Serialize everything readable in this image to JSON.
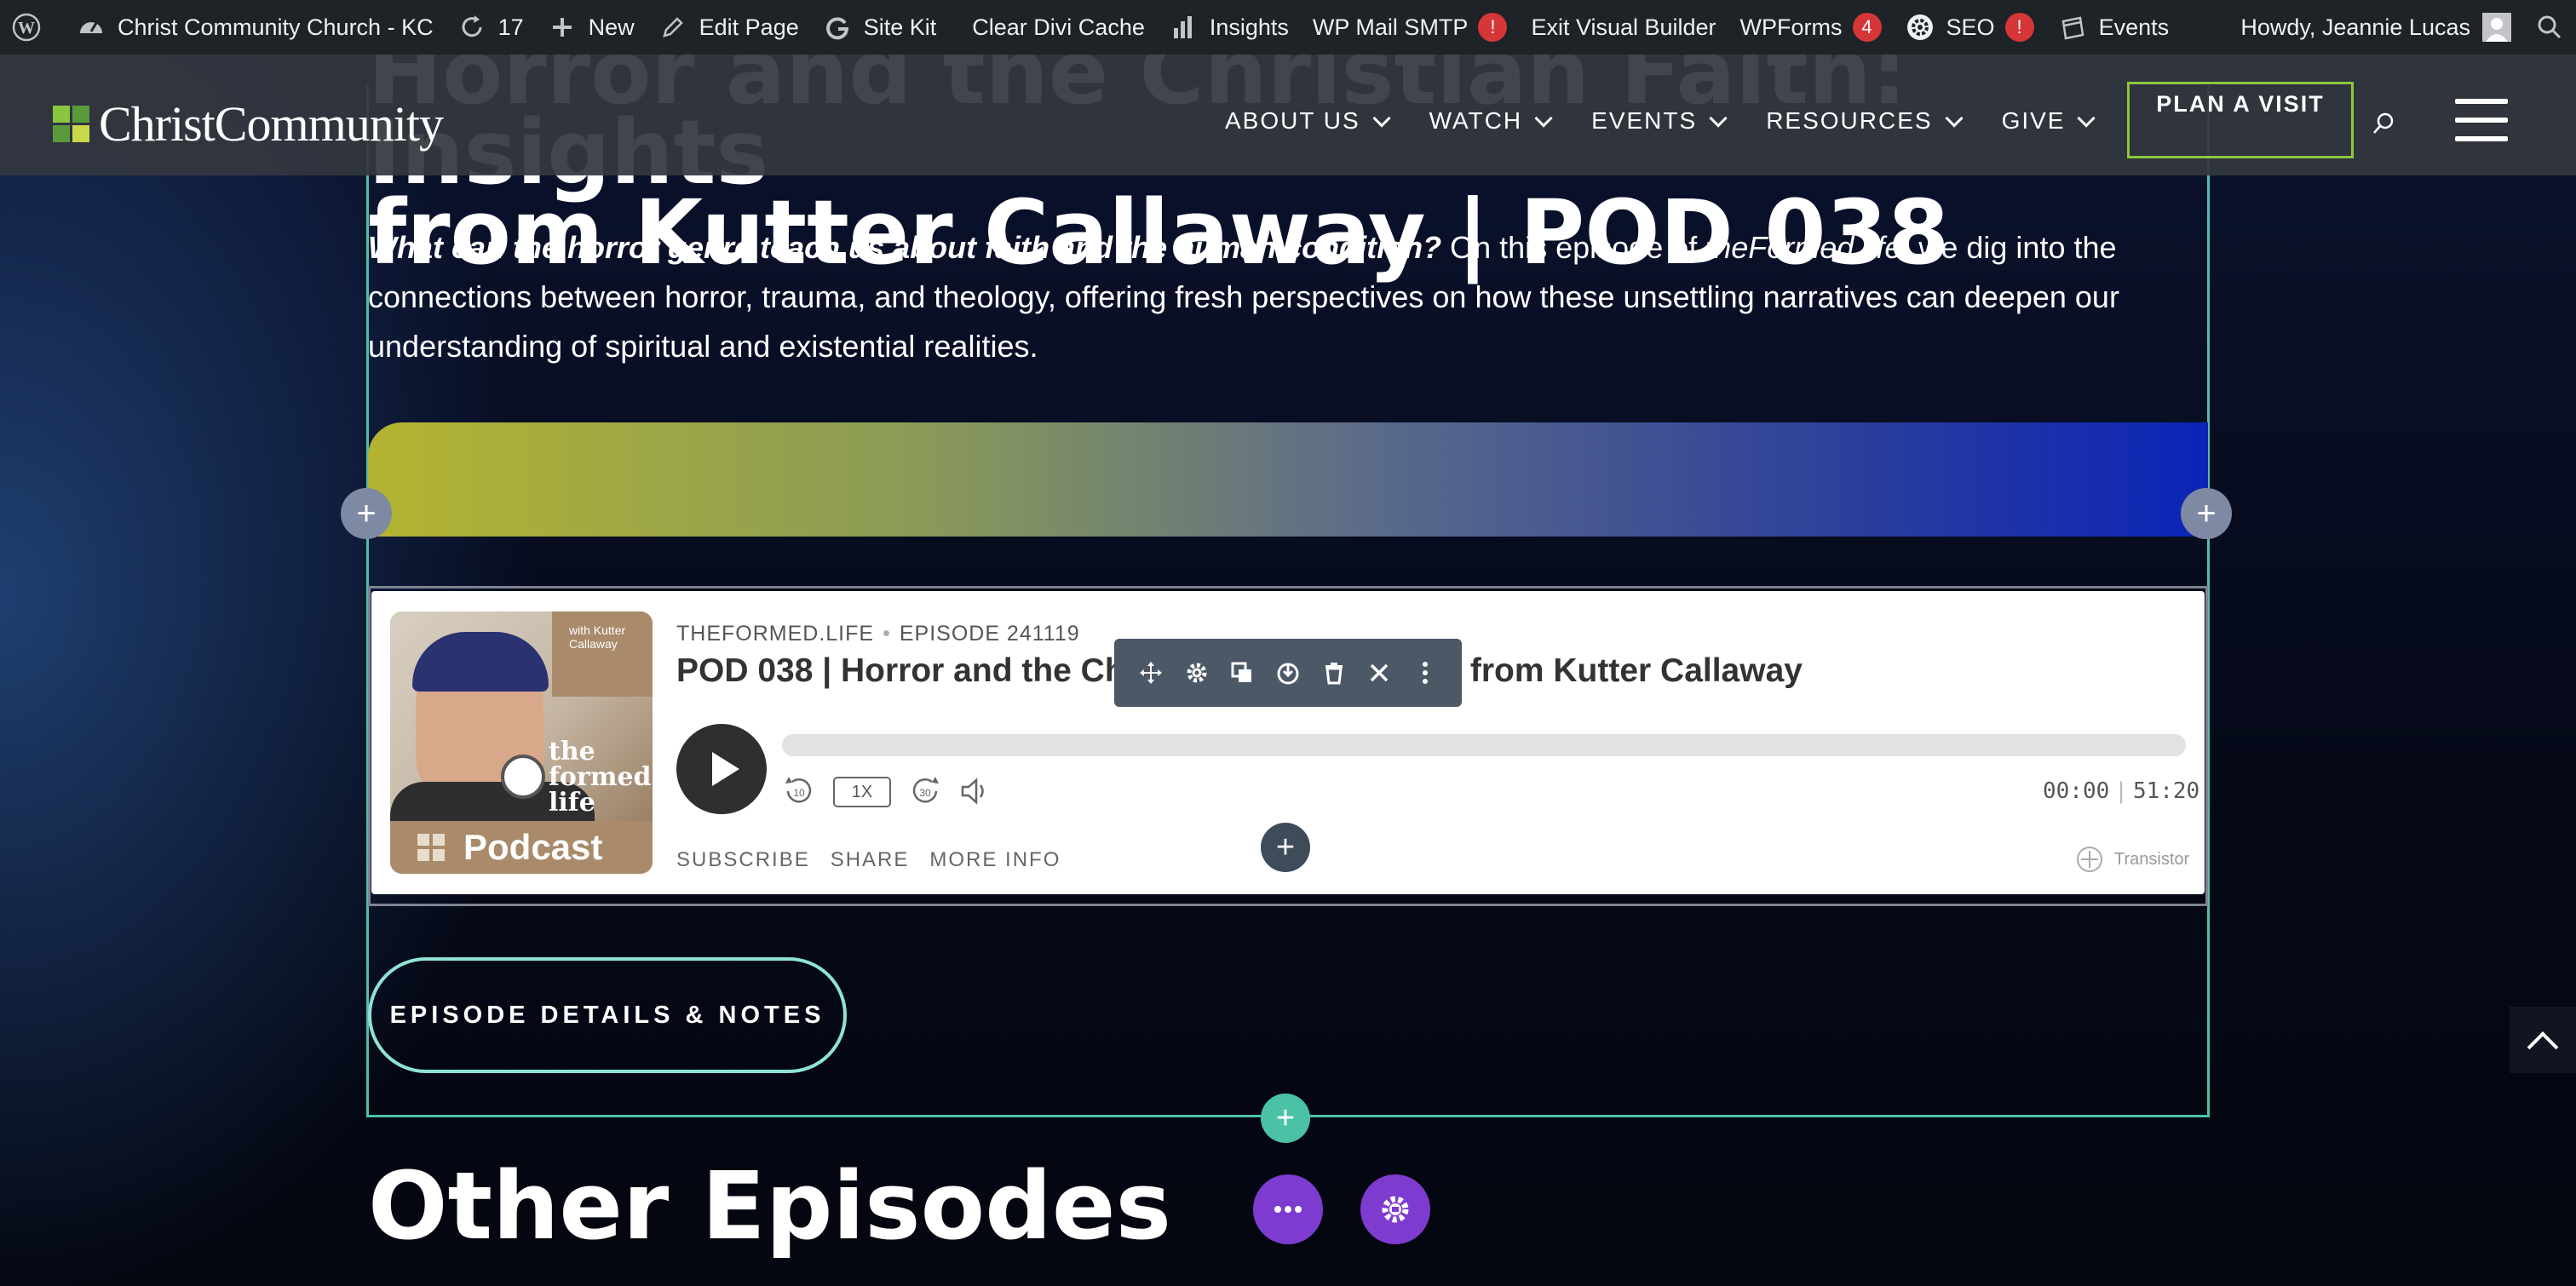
{
  "admin_bar": {
    "site_name": "Christ Community Church - KC",
    "updates_count": "17",
    "new_label": "New",
    "edit_page_label": "Edit Page",
    "site_kit_label": "Site Kit",
    "clear_cache_label": "Clear Divi Cache",
    "insights_label": "Insights",
    "wp_mail_label": "WP Mail SMTP",
    "wp_mail_badge": "!",
    "exit_builder_label": "Exit Visual Builder",
    "wpforms_label": "WPForms",
    "wpforms_badge": "4",
    "seo_label": "SEO",
    "seo_badge": "!",
    "events_label": "Events",
    "greeting": "Howdy, Jeannie Lucas"
  },
  "header": {
    "logo_text": "ChristCommunity",
    "nav": [
      {
        "label": "ABOUT US"
      },
      {
        "label": "WATCH"
      },
      {
        "label": "EVENTS"
      },
      {
        "label": "RESOURCES"
      },
      {
        "label": "GIVE"
      }
    ],
    "cta_label": "PLAN A VISIT"
  },
  "content": {
    "title_line1": "Horror and the Christian Faith: Insights",
    "title_line2": "from Kutter Callaway | POD 038",
    "intro_bold": "What can the horror genre teach us about faith and the human condition?",
    "intro_part1": " On this episode of ",
    "intro_italic": "theFormed.life",
    "intro_part2": ", we dig into the connections between horror, trauma, and theology, offering fresh perspectives on how these unsettling narratives can deepen our understanding of spiritual and existential realities.",
    "episode_button_label": "EPISODE DETAILS & NOTES",
    "other_episodes_title": "Other Episodes"
  },
  "player": {
    "show_name": "THEFORMED.LIFE",
    "episode_label": "EPISODE 241119",
    "episode_title": "POD 038 | Horror and the Christian Faith: Insights from Kutter Callaway",
    "speed": "1X",
    "skip_back": "10",
    "skip_forward": "30",
    "current_time": "00:00",
    "duration": "51:20",
    "progress": 0,
    "links": [
      "SUBSCRIBE",
      "SHARE",
      "MORE INFO"
    ],
    "provider": "Transistor",
    "cover": {
      "tag": "with Kutter Callaway",
      "brand": "the formed life",
      "label": "Podcast"
    }
  },
  "builder": {
    "add_symbol": "+",
    "toolbar_icons": [
      "move-icon",
      "settings-icon",
      "duplicate-icon",
      "save-icon",
      "delete-icon",
      "close-icon",
      "more-icon"
    ]
  },
  "colors": {
    "admin_bar": "#1d2327",
    "header": "#34373e",
    "accent_green": "#8cc63f",
    "builder_teal": "#4bc2a6",
    "builder_purple": "#7e3bd0",
    "badge_red": "#d63638"
  }
}
